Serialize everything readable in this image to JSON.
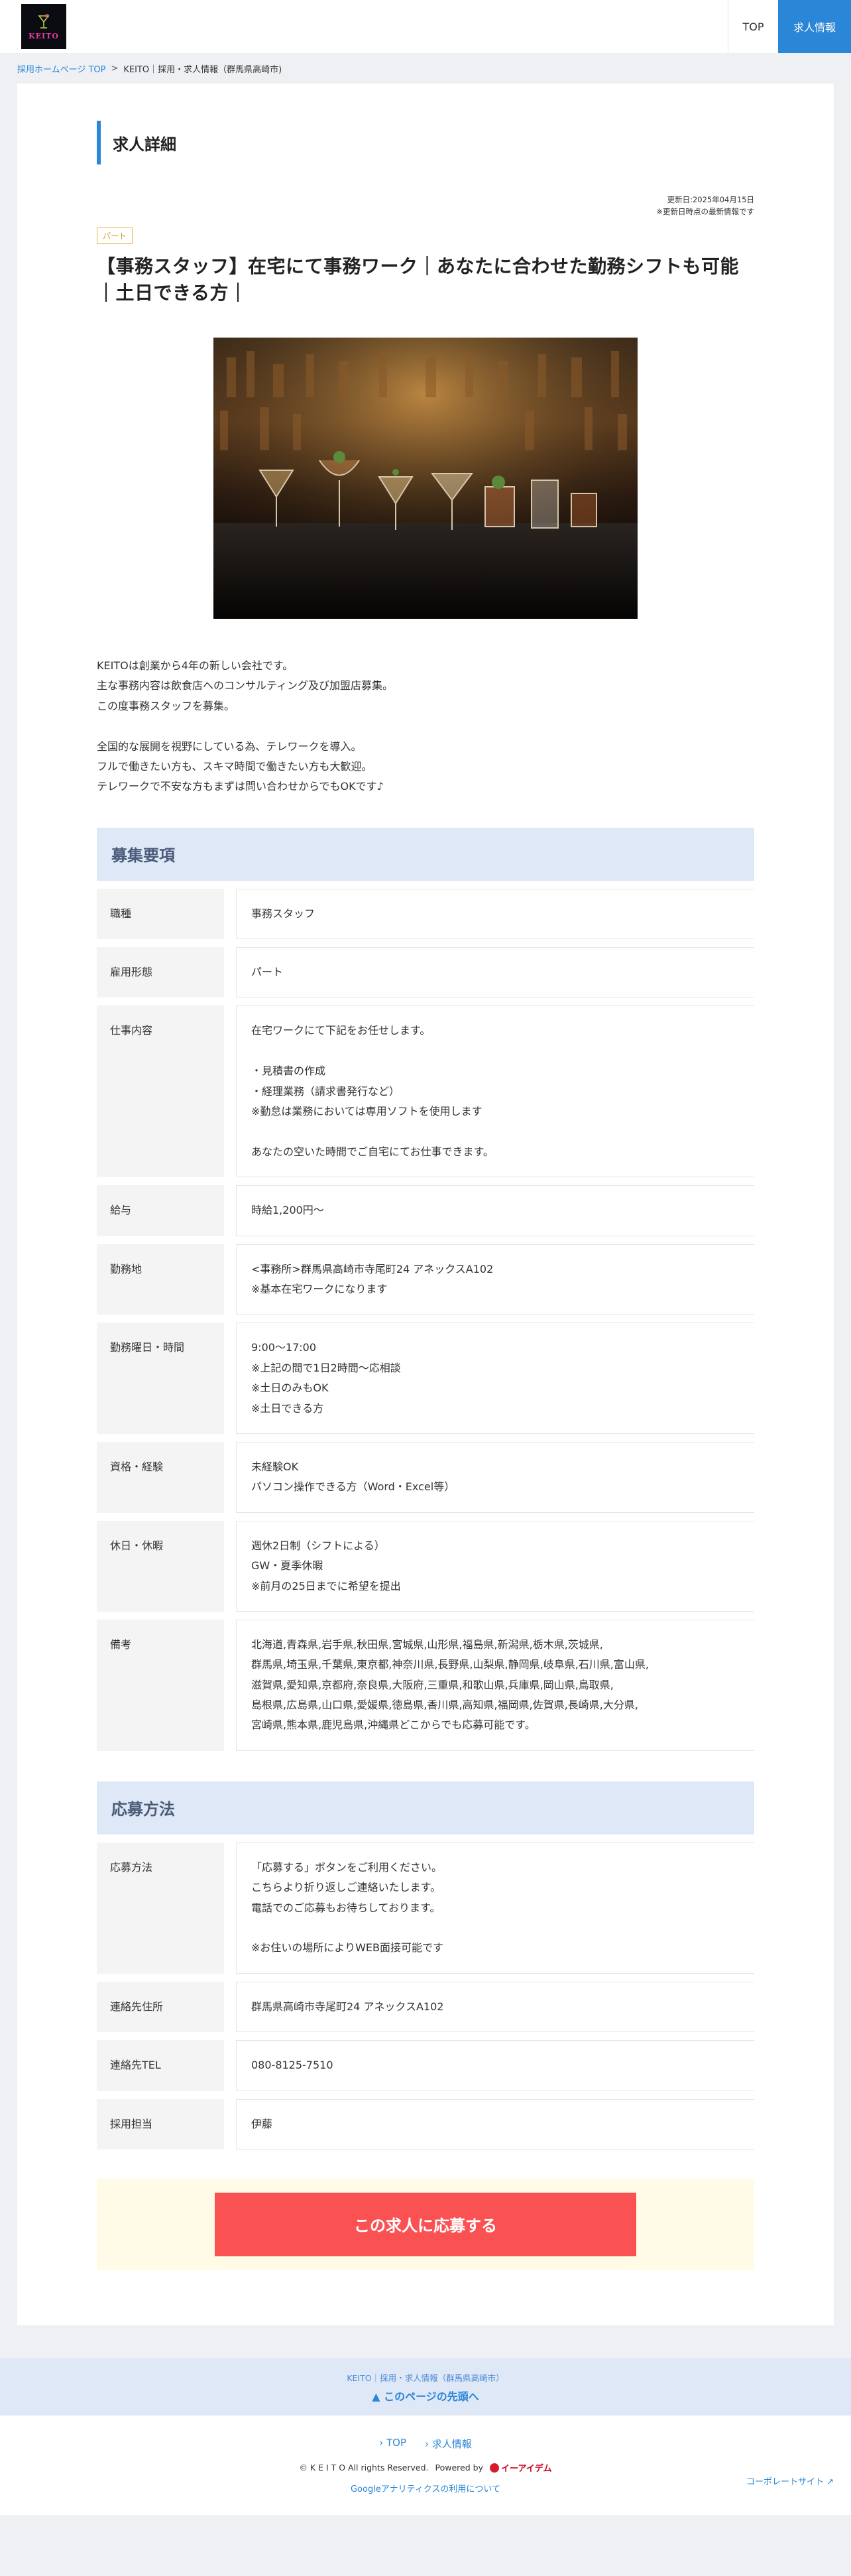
{
  "header": {
    "logo_text": "KEITO",
    "nav_top": "TOP",
    "nav_jobs": "求人情報"
  },
  "breadcrumb": {
    "home": "採用ホームページ TOP",
    "current": "KEITO｜採用・求人情報（群馬県高崎市)"
  },
  "page": {
    "section_title": "求人詳細",
    "updated": "更新日:2025年04月15日",
    "updated_note": "※更新日時点の最新情報です",
    "tag": "パート",
    "job_title": "【事務スタッフ】在宅にて事務ワーク｜あなたに合わせた勤務シフトも可能｜土日できる方｜",
    "intro": "KEITOは創業から4年の新しい会社です。\n主な事務内容は飲食店へのコンサルティング及び加盟店募集。\nこの度事務スタッフを募集。\n\n全国的な展開を視野にしている為、テレワークを導入。\nフルで働きたい方も、スキマ時間で働きたい方も大歓迎。\nテレワークで不安な方もまずは問い合わせからでもOKです♪"
  },
  "requirements": {
    "heading": "募集要項",
    "rows": [
      {
        "label": "職種",
        "value": "事務スタッフ"
      },
      {
        "label": "雇用形態",
        "value": "パート"
      },
      {
        "label": "仕事内容",
        "value": "在宅ワークにて下記をお任せします。\n\n・見積書の作成\n・経理業務（請求書発行など）\n※勤怠は業務においては専用ソフトを使用します\n\nあなたの空いた時間でご自宅にてお仕事できます。"
      },
      {
        "label": "給与",
        "value": "時給1,200円〜"
      },
      {
        "label": "勤務地",
        "value": "<事務所>群馬県高崎市寺尾町24 アネックスA102\n※基本在宅ワークになります"
      },
      {
        "label": "勤務曜日・時間",
        "value": "9:00〜17:00\n※上記の間で1日2時間〜応相談\n※土日のみもOK\n※土日できる方"
      },
      {
        "label": "資格・経験",
        "value": "未経験OK\nパソコン操作できる方（Word・Excel等）"
      },
      {
        "label": "休日・休暇",
        "value": "週休2日制（シフトによる）\nGW・夏季休暇\n※前月の25日までに希望を提出"
      },
      {
        "label": "備考",
        "value": "北海道,青森県,岩手県,秋田県,宮城県,山形県,福島県,新潟県,栃木県,茨城県,\n群馬県,埼玉県,千葉県,東京都,神奈川県,長野県,山梨県,静岡県,岐阜県,石川県,富山県,\n滋賀県,愛知県,京都府,奈良県,大阪府,三重県,和歌山県,兵庫県,岡山県,鳥取県,\n島根県,広島県,山口県,愛媛県,徳島県,香川県,高知県,福岡県,佐賀県,長崎県,大分県,\n宮崎県,熊本県,鹿児島県,沖縄県どこからでも応募可能です。"
      }
    ]
  },
  "application": {
    "heading": "応募方法",
    "rows": [
      {
        "label": "応募方法",
        "value": "「応募する」ボタンをご利用ください。\nこちらより折り返しご連絡いたします。\n電話でのご応募もお待ちしております。\n\n※お住いの場所によりWEB面接可能です"
      },
      {
        "label": "連絡先住所",
        "value": "群馬県高崎市寺尾町24 アネックスA102"
      },
      {
        "label": "連絡先TEL",
        "value": "080-8125-7510"
      },
      {
        "label": "採用担当",
        "value": "伊藤"
      }
    ],
    "apply_button": "この求人に応募する"
  },
  "footer": {
    "crumb": "KEITO｜採用・求人情報（群馬県高崎市）",
    "pagetop": "このページの先頭へ",
    "link_top": "TOP",
    "link_jobs": "求人情報",
    "copyright": "© K E I T O All rights Reserved.",
    "powered_by": "Powered by",
    "powered_brand": "イーアイデム",
    "ga_link": "Googleアナリティクスの利用について",
    "corp_link": "コーポレートサイト"
  },
  "colors": {
    "accent": "#2a86d6",
    "apply": "#fa5252",
    "heading_band": "#dfe8f7",
    "tag": "#d49c1a"
  },
  "icons": [
    "chevron-up-icon",
    "chevron-right-icon",
    "external-link-icon"
  ]
}
